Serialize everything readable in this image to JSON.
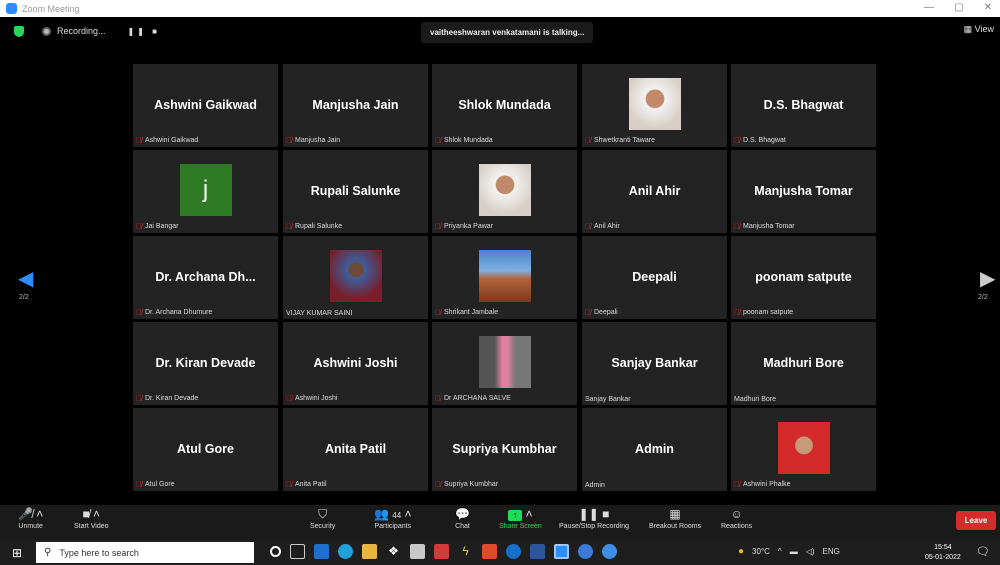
{
  "window": {
    "title": "Zoom Meeting",
    "controls": [
      "—",
      "▢",
      "✕"
    ]
  },
  "topbar": {
    "recording_label": "Recording...",
    "recording_controls": "❚❚ ■",
    "talking": "vaitheeshwaran venkatamani is talking...",
    "view_label": "▦ View"
  },
  "page_indicator": {
    "left": "2/2",
    "right": "2/2"
  },
  "tiles": [
    {
      "display": "Ashwini Gaikwad",
      "label": "Ashwini Gaikwad",
      "muted": true,
      "avatar": "none"
    },
    {
      "display": "Manjusha Jain",
      "label": "Manjusha Jain",
      "muted": true,
      "avatar": "none"
    },
    {
      "display": "Shlok Mundada",
      "label": "Shlok Mundada",
      "muted": true,
      "avatar": "none"
    },
    {
      "display": "",
      "label": "Shwetkranti Taware",
      "muted": true,
      "avatar": "photo-woman-portrait"
    },
    {
      "display": "D.S. Bhagwat",
      "label": "D.S. Bhagwat",
      "muted": true,
      "avatar": "none"
    },
    {
      "display": "",
      "label": "Jai Bangar",
      "muted": true,
      "avatar": "letter",
      "letter": "j"
    },
    {
      "display": "Rupali Salunke",
      "label": "Rupali Salunke",
      "muted": true,
      "avatar": "none"
    },
    {
      "display": "",
      "label": "Priyanka Pawar",
      "muted": true,
      "avatar": "photo-woman-portrait"
    },
    {
      "display": "Anil Ahir",
      "label": "Anil Ahir",
      "muted": true,
      "avatar": "none"
    },
    {
      "display": "Manjusha Tomar",
      "label": "Manjusha Tomar",
      "muted": true,
      "avatar": "none"
    },
    {
      "display": "Dr. Archana Dh...",
      "label": "Dr. Archana Dhumure",
      "muted": true,
      "avatar": "none"
    },
    {
      "display": "",
      "label": "VIJAY KUMAR SAINI",
      "muted": false,
      "avatar": "photo-man-portrait"
    },
    {
      "display": "",
      "label": "Shrikant Jambale",
      "muted": true,
      "avatar": "photo-landscape"
    },
    {
      "display": "Deepali",
      "label": "Deepali",
      "muted": true,
      "avatar": "none"
    },
    {
      "display": "poonam satpute",
      "label": "poonam satpute",
      "muted": true,
      "avatar": "none"
    },
    {
      "display": "Dr. Kiran Devade",
      "label": "Dr. Kiran Devade",
      "muted": true,
      "avatar": "none"
    },
    {
      "display": "Ashwini Joshi",
      "label": "Ashwini Joshi",
      "muted": true,
      "avatar": "none"
    },
    {
      "display": "",
      "label": "Dr ARCHANA SALVE",
      "muted": true,
      "avatar": "photo-woman-standing"
    },
    {
      "display": "Sanjay Bankar",
      "label": "Sanjay Bankar",
      "muted": false,
      "avatar": "none"
    },
    {
      "display": "Madhuri Bore",
      "label": "Madhuri Bore",
      "muted": false,
      "avatar": "none"
    },
    {
      "display": "Atul Gore",
      "label": "Atul Gore",
      "muted": true,
      "avatar": "none"
    },
    {
      "display": "Anita Patil",
      "label": "Anita Patil",
      "muted": true,
      "avatar": "none"
    },
    {
      "display": "Supriya Kumbhar",
      "label": "Supriya Kumbhar",
      "muted": true,
      "avatar": "none"
    },
    {
      "display": "Admin",
      "label": "Admin",
      "muted": false,
      "avatar": "none"
    },
    {
      "display": "",
      "label": "Ashwini Phalke",
      "muted": true,
      "avatar": "photo-woman-red-bg"
    }
  ],
  "toolbar": {
    "unmute": "Unmute",
    "start_video": "Start Video",
    "security": "Security",
    "participants": "Participants",
    "participant_count": "44",
    "chat": "Chat",
    "share_screen": "Share Screen",
    "pause_recording": "Pause/Stop Recording",
    "breakout": "Breakout Rooms",
    "reactions": "Reactions",
    "leave": "Leave"
  },
  "taskbar": {
    "search_placeholder": "Type here to search",
    "temperature": "30°C",
    "language": "ENG",
    "time": "15:54",
    "date": "05-01-2022"
  },
  "colors": {
    "accent": "#2d8cff",
    "muted_mic": "#e02828",
    "leave": "#d72a2a",
    "share": "#23d959"
  }
}
